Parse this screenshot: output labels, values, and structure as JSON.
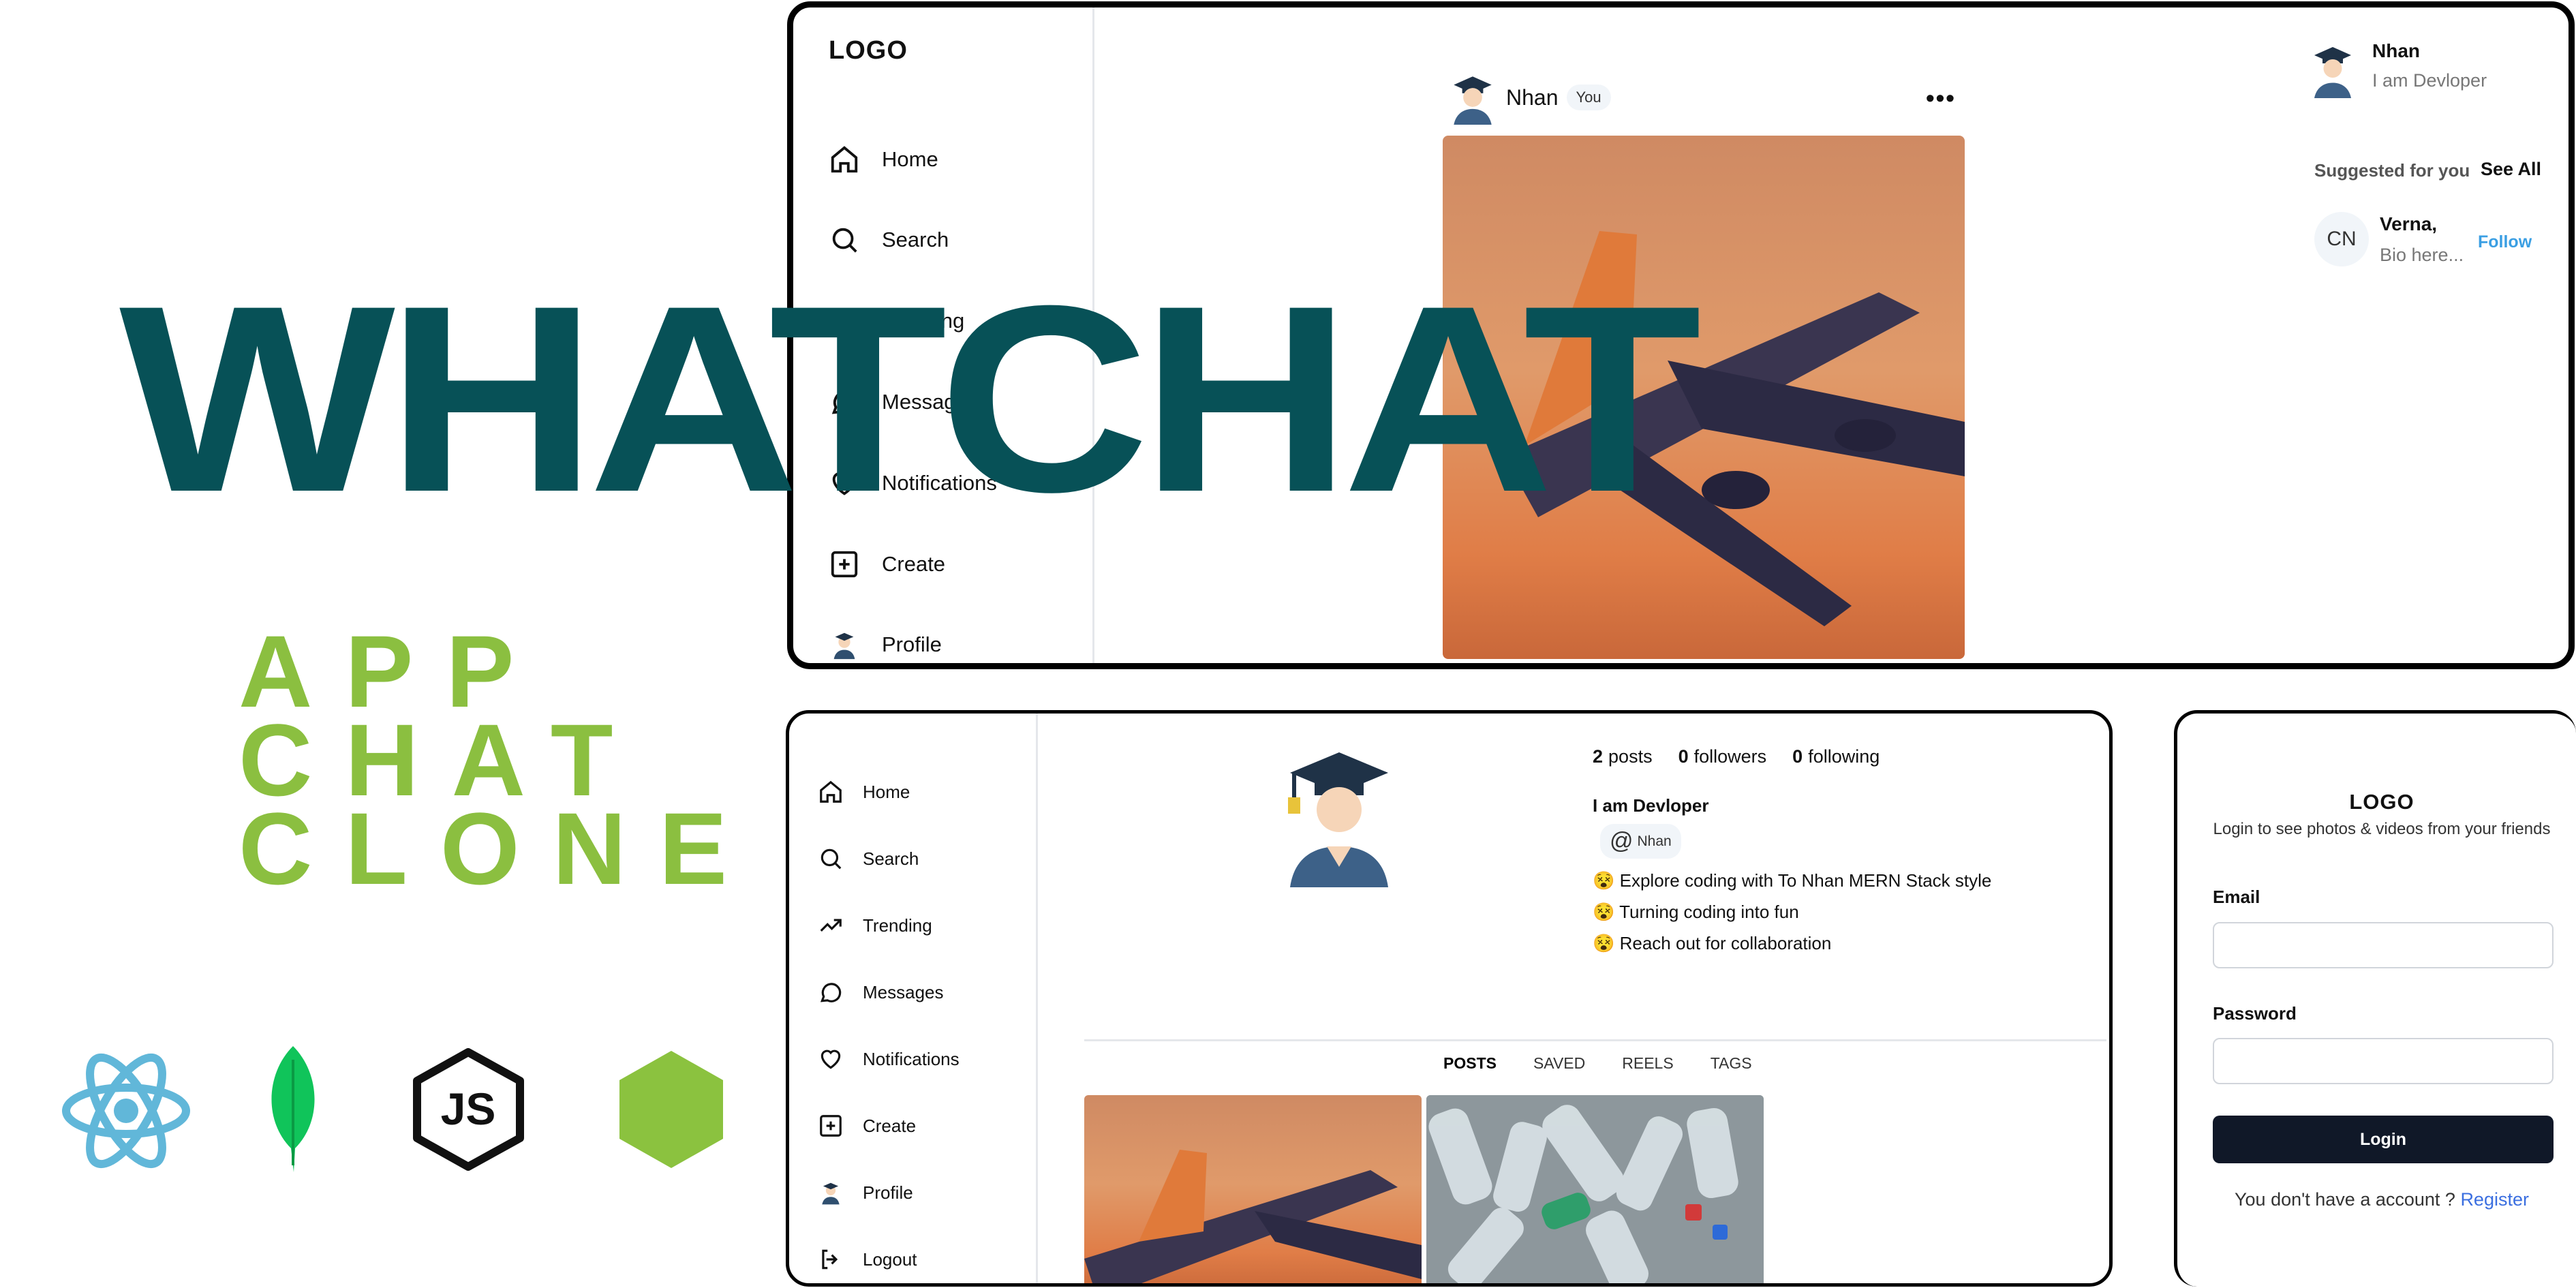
{
  "colors": {
    "title": "#075157",
    "subtitle": "#8bbf40",
    "react": "#61b7d9",
    "mongo": "#10c45a",
    "node_hex": "#8bc23f",
    "follow": "#3b9fe3",
    "login_btn": "#101828",
    "register": "#3b6fe0"
  },
  "branding": {
    "title": "WHATCHAT",
    "subtitle_lines": [
      "APP",
      "CHAT",
      "CLONE"
    ],
    "tech_icons": [
      "react-icon",
      "mongodb-leaf-icon",
      "js-icon",
      "nodejs-hex-icon"
    ]
  },
  "feed": {
    "logo": "LOGO",
    "sidebar": [
      "Home",
      "Search",
      "Trending",
      "Messages",
      "Notifications",
      "Create",
      "Profile"
    ],
    "post": {
      "username": "Nhan",
      "badge": "You",
      "more": "•••"
    },
    "current_user": {
      "name": "Nhan",
      "bio": "I am Devloper"
    },
    "suggested": {
      "heading": "Suggested for you",
      "see_all": "See All",
      "user": {
        "initials": "CN",
        "name": "Verna,",
        "bio": "Bio here...",
        "follow": "Follow"
      }
    }
  },
  "profile": {
    "sidebar": [
      "Home",
      "Search",
      "Trending",
      "Messages",
      "Notifications",
      "Create",
      "Profile",
      "Logout"
    ],
    "stats": {
      "posts_count": "2",
      "posts_label": "posts",
      "followers_count": "0",
      "followers_label": "followers",
      "following_count": "0",
      "following_label": "following"
    },
    "bio_title": "I am Devloper",
    "handle_at": "@",
    "handle": "Nhan",
    "bio_lines": [
      "Explore coding with To Nhan MERN Stack style",
      "Turning coding into fun",
      "Reach out for collaboration"
    ],
    "tabs": [
      "POSTS",
      "SAVED",
      "REELS",
      "TAGS"
    ]
  },
  "login": {
    "logo": "LOGO",
    "tagline": "Login to see photos & videos from your friends",
    "email_label": "Email",
    "email_value": "",
    "password_label": "Password",
    "password_value": "",
    "button": "Login",
    "no_account": "You don't have a account ?",
    "register": "Register"
  }
}
